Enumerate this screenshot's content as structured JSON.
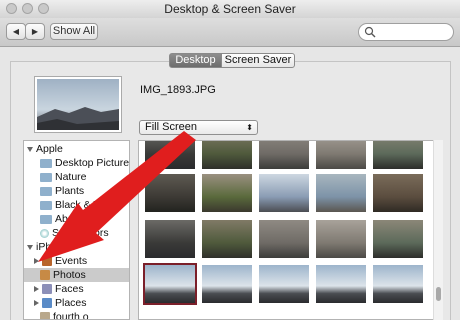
{
  "window": {
    "title": "Desktop & Screen Saver"
  },
  "toolbar": {
    "back_glyph": "◀",
    "forward_glyph": "▶",
    "show_all_label": "Show All",
    "search_icon": "search-icon"
  },
  "tabs": [
    {
      "label": "Desktop",
      "selected": true
    },
    {
      "label": "Screen Saver",
      "selected": false
    }
  ],
  "current": {
    "filename": "IMG_1893.JPG",
    "fit_option": "Fill Screen"
  },
  "sidebar": {
    "groups": [
      {
        "label": "Apple",
        "expanded": true,
        "items": [
          "Desktop Pictures",
          "Nature",
          "Plants",
          "Black & White",
          "Abstract",
          "Solid Colors"
        ]
      },
      {
        "label": "iPhoto",
        "expanded": true,
        "items": [
          {
            "label": "Events",
            "selected": false
          },
          {
            "label": "Photos",
            "selected": true
          },
          {
            "label": "Faces",
            "selected": false
          },
          {
            "label": "Places",
            "selected": false
          },
          {
            "label": "fourth o",
            "selected": false
          }
        ]
      }
    ]
  },
  "colors": {
    "selection": "#c8c8c8",
    "arrow": "#e01e1e",
    "thumb_border_selected": "#7b1f2a"
  }
}
